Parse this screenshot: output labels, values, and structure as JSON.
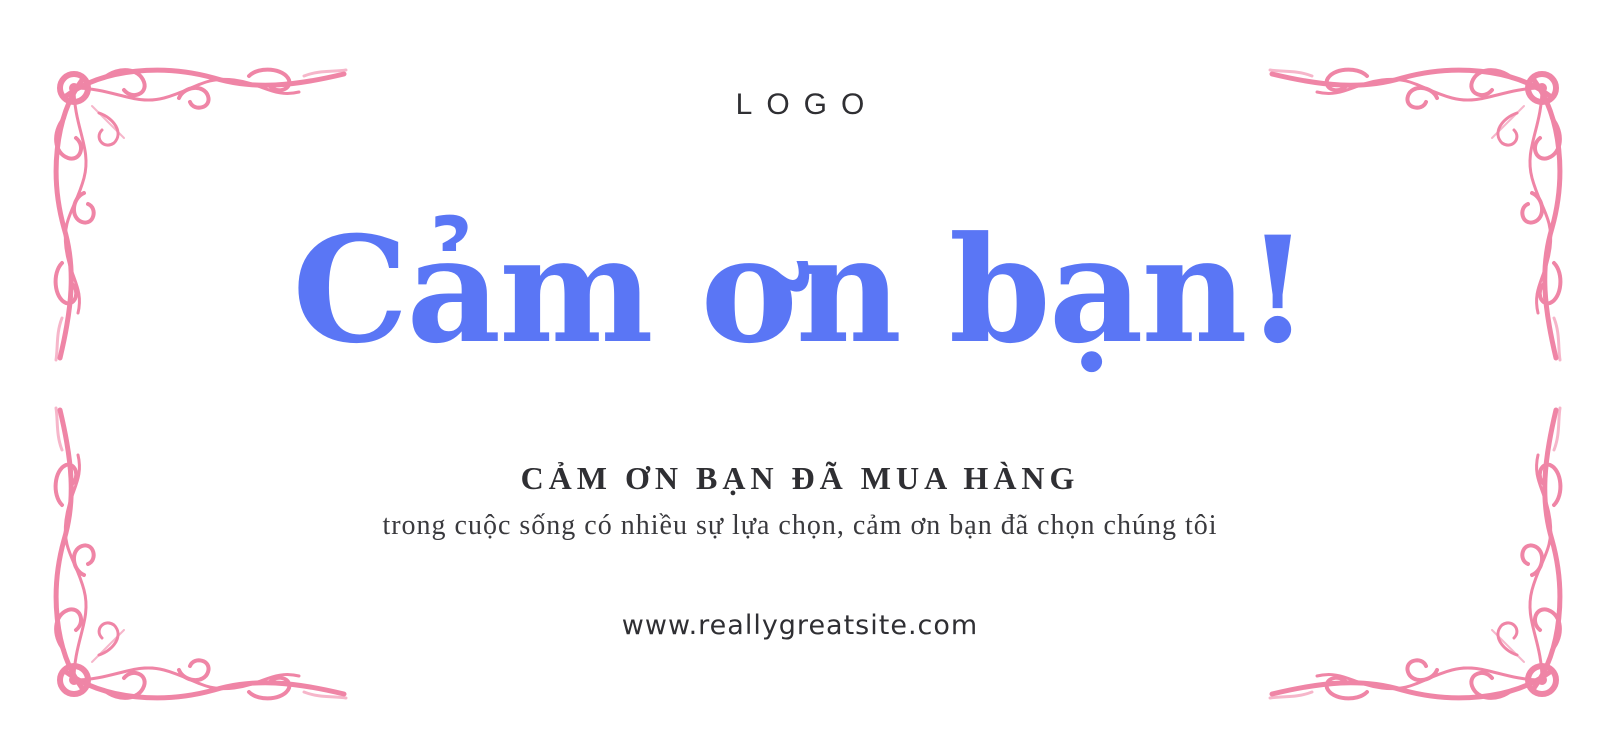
{
  "card": {
    "logo_text": "LOGO",
    "headline": "Cảm ơn bạn!",
    "subtitle": "CẢM ƠN BẠN ĐÃ MUA HÀNG",
    "tagline": "trong cuộc sống có nhiều sự lựa chọn, cảm ơn bạn đã chọn chúng tôi",
    "website": "www.reallygreatsite.com"
  },
  "colors": {
    "headline": "#5a76f5",
    "text": "#2f2f33",
    "ornament": "#ec6f96",
    "background": "#ffffff"
  },
  "decorations": {
    "corner_icon": "floral-flourish-corner"
  }
}
